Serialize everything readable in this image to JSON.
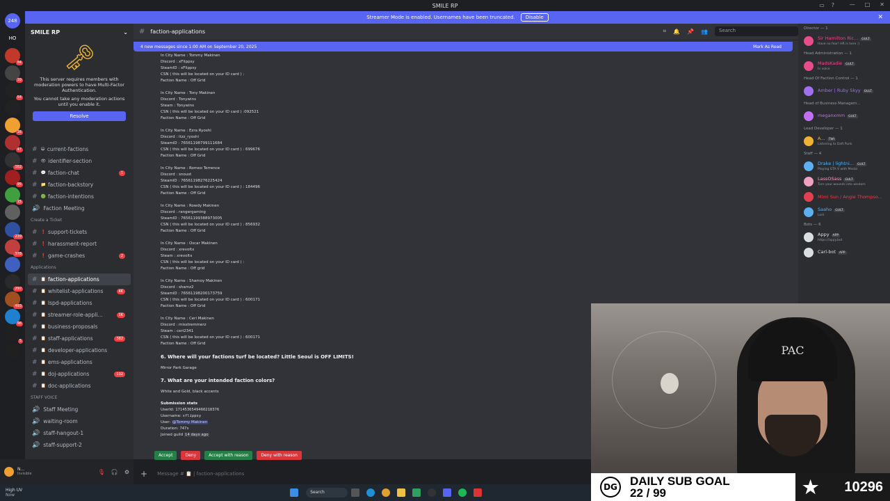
{
  "window": {
    "title": "SMILE RP"
  },
  "streamer_bar": {
    "text": "Streamer Mode is enabled. Usernames have been truncated.",
    "button": "Disable"
  },
  "servers": [
    {
      "label": "248",
      "color": "#5865f2"
    },
    {
      "label": "HO",
      "color": "#1e1f22"
    },
    {
      "label": "",
      "color": "#c0392b",
      "badge": "84"
    },
    {
      "label": "",
      "color": "#444",
      "badge": "10"
    },
    {
      "label": "",
      "color": "#222",
      "badge": "54"
    },
    {
      "label": "",
      "color": "#222"
    },
    {
      "label": "",
      "color": "#f0a030",
      "badge": "16"
    },
    {
      "label": "",
      "color": "#b03030",
      "badge": "47"
    },
    {
      "label": "",
      "color": "#333",
      "badge": "162"
    },
    {
      "label": "",
      "color": "#a02020",
      "badge": "95"
    },
    {
      "label": "",
      "color": "#40a040",
      "badge": "15"
    },
    {
      "label": "",
      "color": "#606060"
    },
    {
      "label": "",
      "color": "#3050a0",
      "badge": "239"
    },
    {
      "label": "",
      "color": "#c04040",
      "badge": "378"
    },
    {
      "label": "",
      "color": "#4060c0"
    },
    {
      "label": "",
      "color": "#2a2a2a",
      "badge": "292"
    },
    {
      "label": "",
      "color": "#a05020",
      "badge": "493"
    },
    {
      "label": "",
      "color": "#2080d0",
      "badge": "98"
    },
    {
      "label": "",
      "color": "#202020",
      "badge": "5"
    },
    {
      "label": "",
      "color": "#202020"
    }
  ],
  "sidebar": {
    "server_name": "SMILE RP",
    "mfa_text": "This server requires members with moderation powers to have Multi-Factor Authentication.",
    "mfa_text2": "You cannot take any moderation actions until you enable it.",
    "resolve": "Resolve",
    "items": [
      {
        "type": "ch",
        "label": "current-factions",
        "emoji": "😀"
      },
      {
        "type": "ch",
        "label": "identifier-section",
        "emoji": "👁"
      },
      {
        "type": "ch",
        "label": "faction-chat",
        "emoji": "💬",
        "badge": "1"
      },
      {
        "type": "ch",
        "label": "faction-backstory",
        "emoji": "📁"
      },
      {
        "type": "ch",
        "label": "faction-intentions",
        "emoji": "🟢"
      },
      {
        "type": "voice",
        "label": "Faction Meeting"
      },
      {
        "type": "cat",
        "label": "Create a Ticket"
      },
      {
        "type": "ch",
        "label": "support-tickets",
        "emoji": "❗"
      },
      {
        "type": "ch",
        "label": "harassment-report",
        "emoji": "❗"
      },
      {
        "type": "ch",
        "label": "game-crashes",
        "emoji": "❗",
        "badge": "2"
      },
      {
        "type": "cat",
        "label": "Applications"
      },
      {
        "type": "ch",
        "label": "faction-applications",
        "emoji": "📋",
        "active": true
      },
      {
        "type": "ch",
        "label": "whitelist-applications",
        "emoji": "📋",
        "badge": "4K"
      },
      {
        "type": "ch",
        "label": "lspd-applications",
        "emoji": "📋"
      },
      {
        "type": "ch",
        "label": "streamer-role-appli...",
        "emoji": "📋",
        "badge": "1K"
      },
      {
        "type": "ch",
        "label": "business-proposals",
        "emoji": "📋"
      },
      {
        "type": "ch",
        "label": "staff-applications",
        "emoji": "📋",
        "badge": "382"
      },
      {
        "type": "ch",
        "label": "developer-applications",
        "emoji": "📋"
      },
      {
        "type": "ch",
        "label": "ems-applications",
        "emoji": "📋"
      },
      {
        "type": "ch",
        "label": "doj-applications",
        "emoji": "📋",
        "badge": "132"
      },
      {
        "type": "ch",
        "label": "doc-applications",
        "emoji": "📋"
      },
      {
        "type": "cat",
        "label": "STAFF VOICE"
      },
      {
        "type": "voice",
        "label": "Staff Meeting"
      },
      {
        "type": "voice",
        "label": "waiting-room"
      },
      {
        "type": "voice",
        "label": "staff-hangout-1"
      },
      {
        "type": "voice",
        "label": "staff-support-2"
      }
    ]
  },
  "user": {
    "name": "N...",
    "status": "Invisible"
  },
  "channel": {
    "name": "faction-applications",
    "search_placeholder": "Search"
  },
  "newmsg": {
    "text": "4 new messages since 1:00 AM on September 20, 2025",
    "mark": "Mark As Read"
  },
  "entries": [
    {
      "lines": [
        "In City Name : Tommy Makinen",
        "Discord : xFlippsy",
        "SteamID : xFlippsy",
        "CSN ( this will be located on your ID card ) :",
        "Faction Name : Off Grid"
      ]
    },
    {
      "lines": [
        "In City Name : Tony Makinen",
        "Discord : Tonywins",
        "Steam : Tonywins",
        "CSN ( this will be located on your ID card ) :092521",
        "Faction Name : Off Grid"
      ]
    },
    {
      "lines": [
        "In City Name : Ezra Ryoshi",
        "Discord : itzz_ryoshi",
        "SteamID : 76561198799111684",
        "CSN ( this will be located on your ID card ) : 699676",
        "Faction Name : Off Grid"
      ]
    },
    {
      "lines": [
        "In City Name : Romeo Terrence",
        "Discord : snoust",
        "SteamID : 76561198276225424",
        "CSN ( this will be located on your ID card ) : 184496",
        "Faction Name : Off Grid"
      ]
    },
    {
      "lines": [
        "In City Name : Rowdy Makinen",
        "Discord : rangergaming",
        "SteamID : 76561199388973005",
        "CSN ( this will be located on your ID card ) : 856932",
        "Faction Name : Off Grid"
      ]
    },
    {
      "lines": [
        "In City Name : Oscar Makinen",
        "Discord : xrevoltx",
        "Steam : xrevoltx",
        "CSN ( this will be located on your ID card ) :",
        "Faction Name : Off grid"
      ]
    },
    {
      "lines": [
        "In City Name : Shamoy Makinen",
        "Discord : shamz2",
        "SteamID : 76561198200173759",
        "CSN ( this will be located on your ID card ) : 600171",
        "Faction Name : Off Grid"
      ]
    },
    {
      "lines": [
        "In City Name : Ceri Makinen",
        "Discord : misstremmerz",
        "Steam : ceri2341",
        "CSN ( this will be located on your ID card ) : 600171",
        "Faction Name : Off Grid"
      ]
    }
  ],
  "q6": {
    "question": "6. Where will your factions turf be located? Little Seoul is OFF LIMITS!",
    "answer": "Mirror Park Garage"
  },
  "q7": {
    "question": "7. What are your intended faction colors?",
    "answer": "White and Gold, black accents"
  },
  "stats": {
    "title": "Submission stats",
    "userid_k": "UserId:",
    "userid_v": "1714536549460218376",
    "username_k": "Username:",
    "username_v": "xflippsy",
    "user_k": "User:",
    "user_v": "@Tommy Makinen",
    "duration_k": "Duration:",
    "duration_v": "747s",
    "joined_k": "Joined guild",
    "joined_v": "14 days ago"
  },
  "actions": {
    "accept": "Accept",
    "deny": "Deny",
    "accept_reason": "Accept with reason",
    "deny_reason": "Deny with reason"
  },
  "composer": {
    "placeholder": "Message # 📋 | faction-applications"
  },
  "members": [
    {
      "role": "Director — 1"
    },
    {
      "name": "Sir Hamilton Ric...",
      "status": "Have no fear! HR is here :)",
      "color": "#e74c8c",
      "tag": "GULT"
    },
    {
      "role": "Head Administration — 1"
    },
    {
      "name": "MadsKadie",
      "status": "In voice",
      "color": "#e74c8c",
      "tag": "GULT"
    },
    {
      "role": "Head Of Faction Control — 1"
    },
    {
      "name": "Amber | Ruby Skyy",
      "status": "",
      "color": "#a070f0",
      "tag": "GULT"
    },
    {
      "role": "Head of Business Managem..."
    },
    {
      "name": "meganxmm",
      "status": "",
      "color": "#c070f0",
      "tag": "GULT"
    },
    {
      "role": "Lead Developer — 1"
    },
    {
      "name": "A...",
      "status": "Listening to Daft Punk",
      "color": "#f0b232",
      "tag": "TWI"
    },
    {
      "role": "Staff — 4"
    },
    {
      "name": "Drake | lightni...",
      "status": "Playing GTA V with Medal",
      "color": "#5ab0f0",
      "tag": "GULT"
    },
    {
      "name": "LassOSass",
      "status": "Turn your wounds into wisdom",
      "color": "#f0a0c0",
      "tag": "GULT"
    },
    {
      "name": "Mimi Sun / Angie Thompso...",
      "status": "",
      "color": "#e04050",
      "tag": ""
    },
    {
      "name": "Saaho",
      "status": "Lost",
      "color": "#5ab0f0",
      "tag": "GULT"
    },
    {
      "role": "Bots — 6"
    },
    {
      "name": "Appy",
      "status": "https://appy.bot",
      "color": "#dbdee1",
      "tag": "APP"
    },
    {
      "name": "Carl-bot",
      "status": "",
      "color": "#dbdee1",
      "tag": "APP"
    }
  ],
  "webcam": {
    "beanie_text": "PAC"
  },
  "sub_goal": {
    "label": "DAILY SUB GOAL",
    "progress": "22 / 99",
    "count": "10296",
    "logo": "DG"
  },
  "taskbar": {
    "search": "Search",
    "weather": "High UV",
    "weather2": "Now"
  }
}
